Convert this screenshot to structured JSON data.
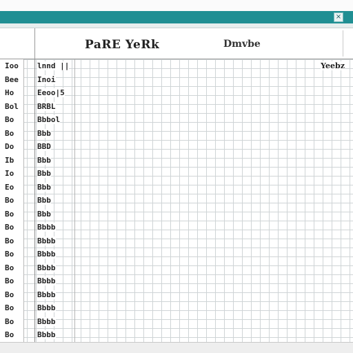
{
  "window": {
    "close_glyph": "×"
  },
  "header": {
    "title": "PaRE YeRk",
    "subtitle": "Dmvbe"
  },
  "corner_label": "Yeebz",
  "rows": [
    {
      "id": "R0",
      "index": "Ioo",
      "value": "lnnd ||"
    },
    {
      "id": "R1",
      "index": "Bee",
      "value": "Inoi"
    },
    {
      "id": "R2",
      "index": "Ho",
      "value": "Eeoo|5"
    },
    {
      "id": "R3",
      "index": "Bol",
      "value": "BRBL"
    },
    {
      "id": "R4",
      "index": "Bo",
      "value": "Bbbol"
    },
    {
      "id": "R5",
      "index": "Bo",
      "value": "Bbb"
    },
    {
      "id": "R6",
      "index": "Do",
      "value": "BBD"
    },
    {
      "id": "R7",
      "index": "Ib",
      "value": "Bbb"
    },
    {
      "id": "R8",
      "index": "Io",
      "value": "Bbb"
    },
    {
      "id": "R9",
      "index": "Eo",
      "value": "Bbb"
    },
    {
      "id": "R10",
      "index": "Bo",
      "value": "Bbb"
    },
    {
      "id": "R11",
      "index": "Bo",
      "value": "Bbb"
    },
    {
      "id": "R12",
      "index": "Bo",
      "value": "Bbbb"
    },
    {
      "id": "R13",
      "index": "Bo",
      "value": "Bbbb"
    },
    {
      "id": "R14",
      "index": "Bo",
      "value": "Bbbb"
    },
    {
      "id": "R15",
      "index": "Bo",
      "value": "Bbbb"
    },
    {
      "id": "R16",
      "index": "Bo",
      "value": "Bbbb"
    },
    {
      "id": "R17",
      "index": "Bo",
      "value": "Bbbb"
    },
    {
      "id": "R18",
      "index": "Bo",
      "value": "Bbbb"
    },
    {
      "id": "R19",
      "index": "Bo",
      "value": "Bbbb"
    },
    {
      "id": "R20",
      "index": "Bo",
      "value": "Bbbb"
    }
  ],
  "colors": {
    "titlebar": "#1f8f93",
    "grid_line": "#cfd4d6",
    "text": "#222222"
  }
}
